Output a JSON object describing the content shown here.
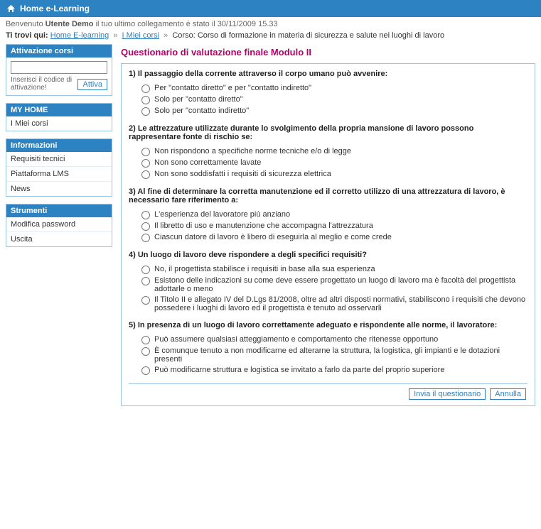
{
  "topbar": {
    "title": "Home e-Learning"
  },
  "welcome": {
    "prefix": "Benvenuto",
    "user": "Utente Demo",
    "last_login_text": "il tuo ultimo collegamento è stato il",
    "last_login": "30/11/2009 15.33"
  },
  "breadcrumb": {
    "label": "Ti trovi qui:",
    "items": [
      {
        "label": "Home E-learning",
        "link": true
      },
      {
        "label": "I Miei corsi",
        "link": true
      },
      {
        "label": "Corso: Corso di formazione in materia di sicurezza e salute nei luoghi di lavoro",
        "link": false
      }
    ]
  },
  "sidebar": {
    "activation": {
      "title": "Attivazione corsi",
      "hint": "Inserisci il codice di attivazione!",
      "button": "Attiva"
    },
    "myhome": {
      "title": "MY HOME",
      "items": [
        "I Miei corsi"
      ]
    },
    "info": {
      "title": "Informazioni",
      "items": [
        "Requisiti tecnici",
        "Piattaforma LMS",
        "News"
      ]
    },
    "tools": {
      "title": "Strumenti",
      "items": [
        "Modifica password",
        "Uscita"
      ]
    }
  },
  "main": {
    "title": "Questionario di valutazione finale Modulo II",
    "questions": [
      {
        "text": "1) Il passaggio della corrente attraverso il corpo umano può avvenire:",
        "options": [
          "Per \"contatto diretto\" e per \"contatto indiretto\"",
          "Solo per \"contatto diretto\"",
          "Solo per \"contatto indiretto\""
        ]
      },
      {
        "text": "2) Le attrezzature utilizzate durante lo svolgimento della propria mansione di lavoro possono rappresentare fonte di rischio se:",
        "options": [
          "Non rispondono a specifiche norme tecniche e/o di legge",
          "Non sono correttamente lavate",
          "Non sono soddisfatti i requisiti di sicurezza elettrica"
        ]
      },
      {
        "text": "3) Al fine di determinare la corretta manutenzione ed il corretto utilizzo di una attrezzatura di lavoro, è necessario fare riferimento a:",
        "options": [
          "L'esperienza del lavoratore più anziano",
          "Il libretto di uso e manutenzione che accompagna l'attrezzatura",
          "Ciascun datore di lavoro è libero di eseguirla al meglio e come crede"
        ]
      },
      {
        "text": "4) Un luogo di lavoro deve rispondere a degli specifici requisiti?",
        "options": [
          "No, il progettista stabilisce i requisiti in base alla sua esperienza",
          "Esistono delle indicazioni su come deve essere progettato un luogo di lavoro ma è facoltà del progettista adottarle o meno",
          "Il Titolo II e allegato IV del D.Lgs 81/2008, oltre ad altri disposti normativi, stabiliscono i requisiti che devono possedere i luoghi di lavoro ed il progettista è tenuto ad osservarli"
        ]
      },
      {
        "text": "5) In presenza di un luogo di lavoro correttamente adeguato e rispondente alle norme, il lavoratore:",
        "options": [
          "Può assumere qualsiasi atteggiamento e comportamento che ritenesse opportuno",
          "È comunque tenuto a non modificarne ed alterarne la struttura, la logistica, gli impianti e le dotazioni presenti",
          "Può modificarne struttura e logistica se invitato a farlo da parte del proprio superiore"
        ]
      }
    ],
    "buttons": {
      "submit": "Invia il questionario",
      "cancel": "Annulla"
    }
  }
}
